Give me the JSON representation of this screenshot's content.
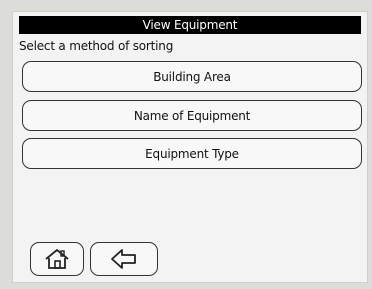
{
  "header": {
    "title": "View Equipment"
  },
  "main": {
    "prompt": "Select a method of sorting",
    "options": [
      {
        "label": "Building Area"
      },
      {
        "label": "Name of Equipment"
      },
      {
        "label": "Equipment Type"
      }
    ]
  },
  "footer": {
    "buttons": [
      {
        "icon": "home-icon"
      },
      {
        "icon": "back-arrow-icon"
      }
    ]
  },
  "colors": {
    "title_bar_bg": "#000000",
    "title_bar_fg": "#ffffff",
    "screen_bg": "#f3f3f3",
    "border": "#333333"
  }
}
